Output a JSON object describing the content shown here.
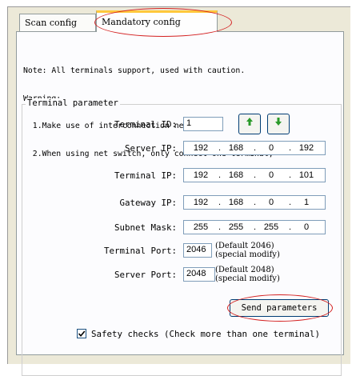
{
  "tabs": {
    "scan": "Scan config",
    "mandatory": "Mandatory config"
  },
  "note": {
    "line1": "Note: All terminals support, used with caution.",
    "line2": "Warning:",
    "line3": "  1.Make use of interconnection net cable;",
    "line4": "  2.When using net switch, only connect one terminal;"
  },
  "group_title": "Terminal parameter",
  "terminal_id": {
    "label": "Terminal ID:",
    "value": "1"
  },
  "arrows": {
    "up_icon": "arrow-up",
    "down_icon": "arrow-down",
    "color": "#2a9a2a"
  },
  "server_ip": {
    "label": "Server IP:",
    "octets": [
      "192",
      "168",
      "0",
      "192"
    ]
  },
  "terminal_ip": {
    "label": "Terminal IP:",
    "octets": [
      "192",
      "168",
      "0",
      "101"
    ]
  },
  "gateway_ip": {
    "label": "Gateway IP:",
    "octets": [
      "192",
      "168",
      "0",
      "1"
    ]
  },
  "subnet_mask": {
    "label": "Subnet Mask:",
    "octets": [
      "255",
      "255",
      "255",
      "0"
    ]
  },
  "terminal_port": {
    "label": "Terminal Port:",
    "value": "2046",
    "hint1": "(Default 2046)",
    "hint2": "(special modify)"
  },
  "server_port": {
    "label": "Server Port:",
    "value": "2048",
    "hint1": "(Default 2048)",
    "hint2": "(special modify)"
  },
  "send_button": "Send parameters",
  "safety": {
    "checked": true,
    "label": "Safety checks (Check more than one terminal)"
  },
  "colors": {
    "highlight_circle": "#d42020",
    "active_tab_top": "#ffc83c"
  }
}
